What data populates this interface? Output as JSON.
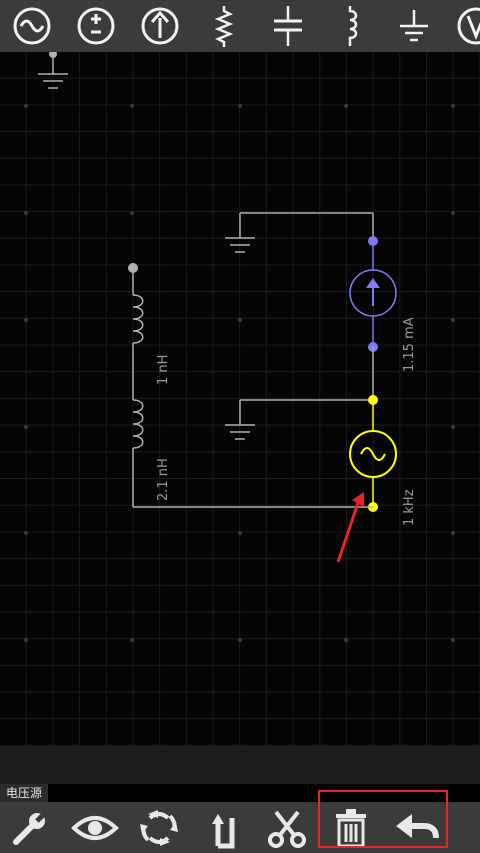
{
  "top_toolbar": {
    "items": [
      {
        "name": "ac-source-icon"
      },
      {
        "name": "dc-source-icon"
      },
      {
        "name": "current-source-icon"
      },
      {
        "name": "resistor-icon"
      },
      {
        "name": "capacitor-icon"
      },
      {
        "name": "inductor-icon"
      },
      {
        "name": "ground-icon"
      },
      {
        "name": "voltmeter-icon"
      }
    ]
  },
  "circuit": {
    "current_source_label": "1.15 mA",
    "ac_source_label": "1 kHz",
    "inductor1_label": "1 nH",
    "inductor2_label": "2.1 nH",
    "colors": {
      "wire": "#b0b0b0",
      "current_source": "#7b7bf5",
      "selected_source": "#ffff00",
      "annotation_arrow": "#e8232a"
    }
  },
  "status": {
    "selected_component": "电压源"
  },
  "bottom_toolbar": {
    "items": [
      {
        "name": "settings-wrench-icon"
      },
      {
        "name": "view-eye-icon"
      },
      {
        "name": "rotate-icon"
      },
      {
        "name": "flip-icon"
      },
      {
        "name": "cut-icon"
      },
      {
        "name": "delete-trash-icon"
      },
      {
        "name": "undo-arrow-icon"
      }
    ],
    "highlight_color": "#e8232a"
  }
}
